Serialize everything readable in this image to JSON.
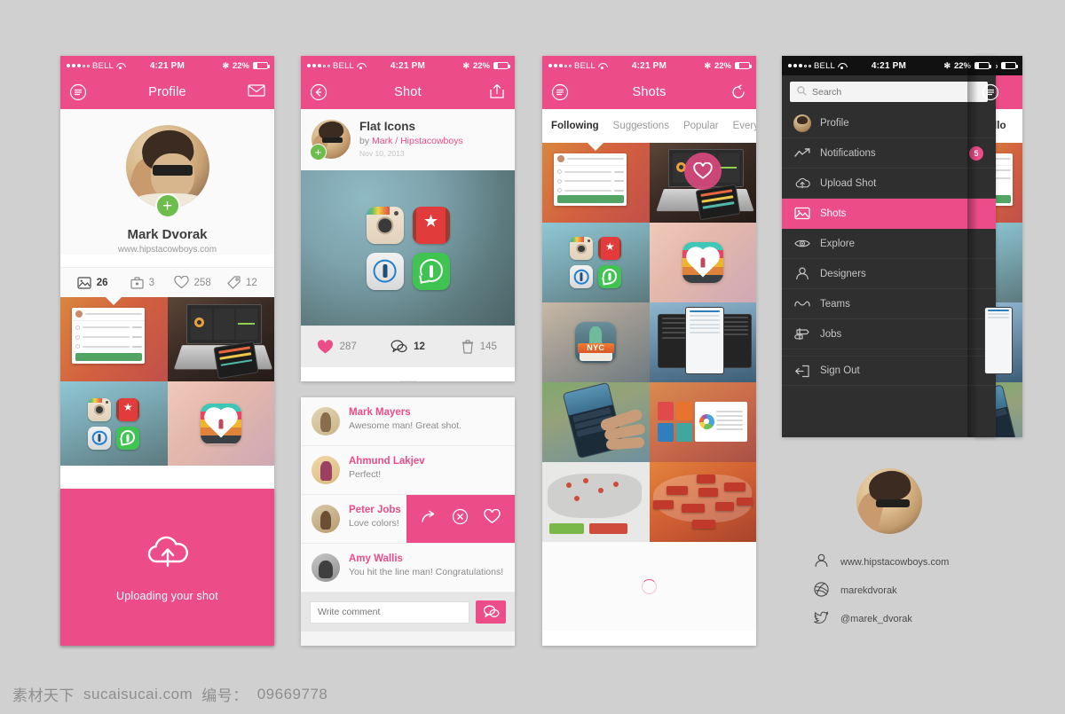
{
  "status_bar": {
    "carrier": "BELL",
    "time": "4:21 PM",
    "battery": "22%",
    "signal_dots_filled": 3,
    "signal_dots_empty": 2
  },
  "profile_screen": {
    "nav": {
      "title": "Profile",
      "left_icon": "hamburger-icon",
      "right_icon": "mail-icon"
    },
    "user": {
      "name": "Mark Dvorak",
      "url": "www.hipstacowboys.com",
      "add_badge": "+"
    },
    "stats": [
      {
        "icon": "photo-icon",
        "value": "26",
        "highlight": true
      },
      {
        "icon": "bucket-icon",
        "value": "3",
        "highlight": false
      },
      {
        "icon": "heart-icon",
        "value": "258",
        "highlight": false
      },
      {
        "icon": "tag-icon",
        "value": "12",
        "highlight": false
      }
    ],
    "thumbnails": [
      "invoice-app-shot",
      "laptop-dashboard-shot",
      "flat-app-icons-shot",
      "heart-lock-icon-shot"
    ]
  },
  "upload_card": {
    "icon": "cloud-upload-icon",
    "label": "Uploading your shot",
    "color": "#ec4c88"
  },
  "shot_screen": {
    "nav": {
      "title": "Shot",
      "left_icon": "back-arrow-icon",
      "right_icon": "share-icon"
    },
    "title": "Flat Icons",
    "by_prefix": "by ",
    "author": "Mark / Hipstacowboys",
    "date": "Nov 10, 2013",
    "add_badge": "+",
    "stats": [
      {
        "icon": "heart-filled-icon",
        "value": "287",
        "highlight": false
      },
      {
        "icon": "comment-icon",
        "value": "12",
        "highlight": true
      },
      {
        "icon": "bucket-trash-icon",
        "value": "145",
        "highlight": false
      }
    ],
    "artwork_icons": [
      "instagram-icon",
      "wunderlist-icon",
      "onepassword-icon",
      "whatsapp-icon"
    ]
  },
  "comments_screen": {
    "comments": [
      {
        "name": "Mark Mayers",
        "text": "Awesome man! Great shot.",
        "swiped": false
      },
      {
        "name": "Ahmund Lakjev",
        "text": "Perfect!",
        "swiped": false
      },
      {
        "name": "Peter Jobs",
        "text": "Love colors!",
        "swiped": true
      },
      {
        "name": "Amy Wallis",
        "text": "You hit the line man! Congratulations!",
        "swiped": false
      }
    ],
    "swipe_actions": [
      "reply-icon",
      "delete-icon",
      "like-icon"
    ],
    "input_placeholder": "Write comment",
    "send_icon": "comment-send-icon"
  },
  "shots_screen": {
    "nav": {
      "title": "Shots",
      "left_icon": "hamburger-icon",
      "right_icon": "refresh-icon"
    },
    "tabs": [
      {
        "label": "Following",
        "active": true
      },
      {
        "label": "Suggestions",
        "active": false
      },
      {
        "label": "Popular",
        "active": false
      },
      {
        "label": "Everyone",
        "active": false
      }
    ],
    "thumbnails": [
      "invoice-app-shot",
      "laptop-dashboard-shot",
      "flat-app-icons-shot",
      "heart-lock-icon-shot",
      "nyc-guide-icon-shot",
      "app-screens-shot",
      "hand-phone-shot",
      "dashboard-ui-shot",
      "europe-map-shot",
      "world-map-tags-shot"
    ],
    "loading": "spinner"
  },
  "menu_screen": {
    "search_placeholder": "Search",
    "search_icon": "search-icon",
    "items": [
      {
        "label": "Profile",
        "icon": "avatar-icon",
        "active": false,
        "badge": null
      },
      {
        "label": "Notifications",
        "icon": "activity-icon",
        "active": false,
        "badge": "5"
      },
      {
        "label": "Upload Shot",
        "icon": "cloud-upload-icon",
        "active": false,
        "badge": null
      },
      {
        "label": "Shots",
        "icon": "photo-icon",
        "active": true,
        "badge": null
      },
      {
        "label": "Explore",
        "icon": "eye-icon",
        "active": false,
        "badge": null
      },
      {
        "label": "Designers",
        "icon": "person-icon",
        "active": false,
        "badge": null
      },
      {
        "label": "Teams",
        "icon": "teams-icon",
        "active": false,
        "badge": null
      },
      {
        "label": "Jobs",
        "icon": "signpost-icon",
        "active": false,
        "badge": null
      },
      {
        "label": "Sign Out",
        "icon": "signout-icon",
        "active": false,
        "badge": null
      }
    ],
    "peek_nav_title": "Follo"
  },
  "identity": {
    "rows": [
      {
        "icon": "person-icon",
        "text": "www.hipstacowboys.com"
      },
      {
        "icon": "dribbble-icon",
        "text": "marekdvorak"
      },
      {
        "icon": "twitter-icon",
        "text": "@marek_dvorak"
      }
    ]
  },
  "watermark": {
    "cn": "素材天下",
    "site": "sucaisucai.com",
    "id_label": "编号：",
    "id_value": "09669778"
  },
  "colors": {
    "accent": "#ec4c88",
    "dark": "#2f2f2f",
    "green": "#6dbd4c",
    "page_bg": "#d0d0d0"
  }
}
